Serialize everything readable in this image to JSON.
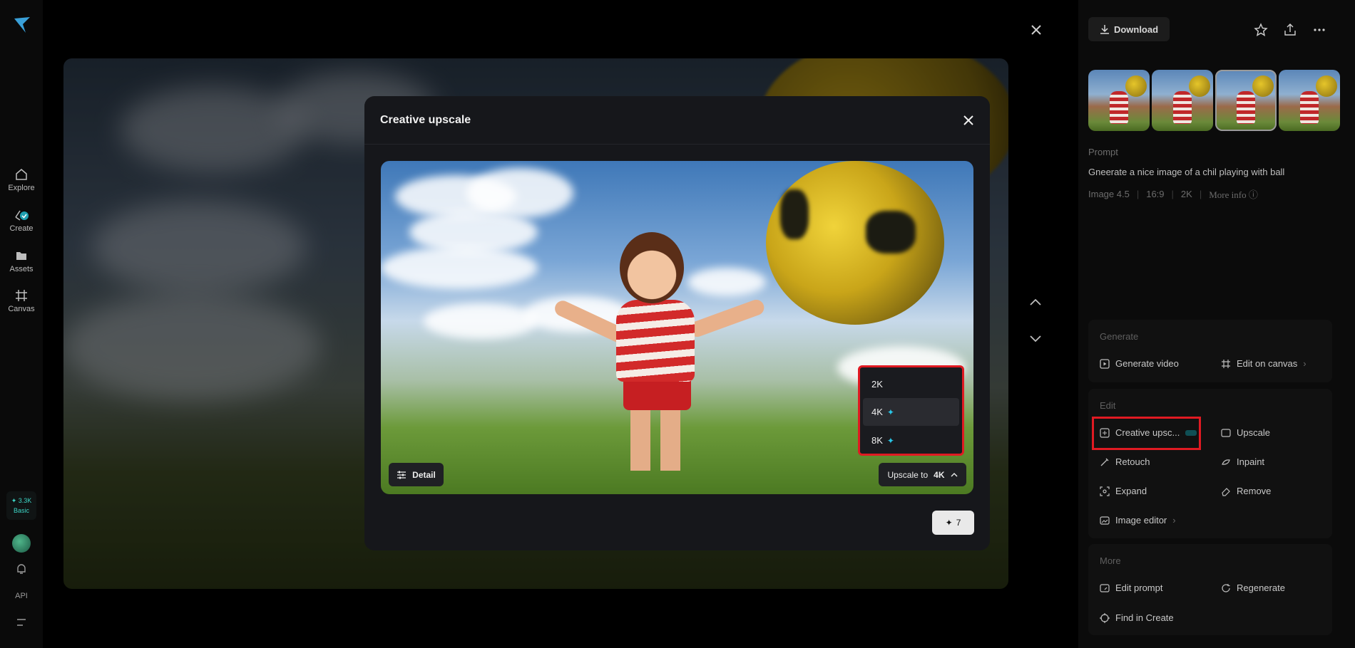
{
  "rail": {
    "items": [
      {
        "label": "Explore",
        "icon": "home-icon"
      },
      {
        "label": "Create",
        "icon": "create-icon"
      },
      {
        "label": "Assets",
        "icon": "folder-icon"
      },
      {
        "label": "Canvas",
        "icon": "canvas-icon"
      }
    ],
    "credits": "3.3K",
    "plan": "Basic",
    "api": "API"
  },
  "panel": {
    "download": "Download",
    "prompt_label": "Prompt",
    "prompt_text": "Gneerate a nice image of a chil playing with ball",
    "meta": [
      "Image 4.5",
      "16:9",
      "2K"
    ],
    "more_info": "More info",
    "sections": {
      "generate": {
        "title": "Generate",
        "actions": [
          "Generate video",
          "Edit on canvas"
        ]
      },
      "edit": {
        "title": "Edit",
        "actions": [
          "Creative upsc...",
          "Upscale",
          "Retouch",
          "Inpaint",
          "Expand",
          "Remove",
          "Image editor"
        ]
      },
      "more": {
        "title": "More",
        "actions": [
          "Edit prompt",
          "Regenerate",
          "Find in Create"
        ]
      }
    }
  },
  "modal": {
    "title": "Creative upscale",
    "detail": "Detail",
    "upscale_label": "Upscale to",
    "upscale_value": "4K",
    "options": [
      "2K",
      "4K",
      "8K"
    ],
    "selected": "4K",
    "cost": "7"
  },
  "colors": {
    "accent_cyan": "#29c7e8",
    "highlight_red": "#e01a22",
    "modal_bg": "#16171b"
  }
}
